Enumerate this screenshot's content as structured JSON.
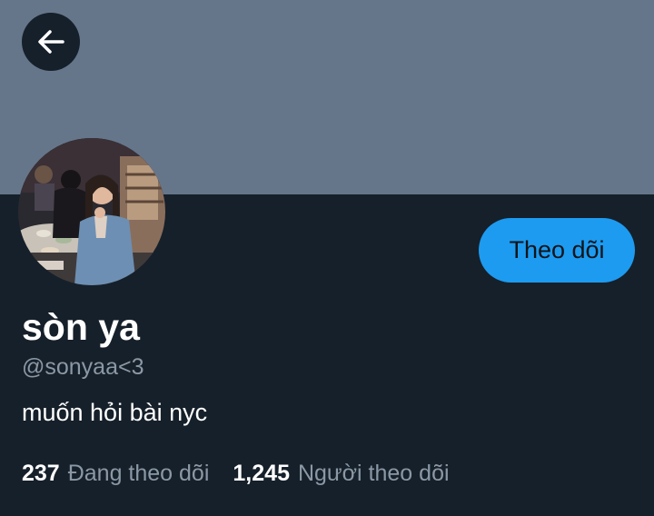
{
  "profile": {
    "display_name": "sòn ya",
    "handle": "@sonyaa<3",
    "bio": "muốn hỏi bài nyc"
  },
  "actions": {
    "follow_label": "Theo dõi",
    "back_icon": "arrow-left-icon"
  },
  "stats": {
    "following_count": "237",
    "following_label": "Đang theo dõi",
    "followers_count": "1,245",
    "followers_label": "Người theo dõi"
  },
  "colors": {
    "banner": "#66768a",
    "background": "#15202b",
    "accent": "#1d9bf0",
    "secondary_text": "#8b98a5"
  }
}
